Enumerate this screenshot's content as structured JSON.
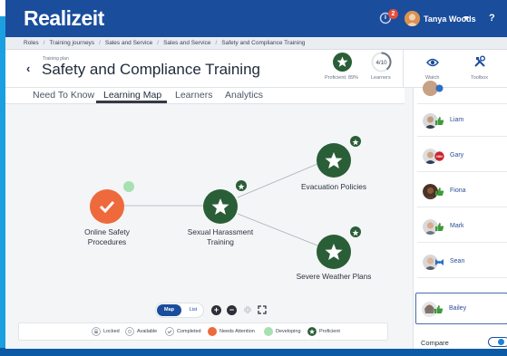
{
  "app": {
    "logo": "Realizeit",
    "notification_count": "2",
    "user_name": "Tanya Woods",
    "help": "?"
  },
  "breadcrumb": [
    "Roles",
    "Training journeys",
    "Sales and Service",
    "Sales and Service",
    "Safety and Compliance Training"
  ],
  "header": {
    "back": "‹",
    "subtitle": "Training plan",
    "title": "Safety and Compliance Training",
    "proficient": "Proficient: 89%",
    "learners_count": "4/10",
    "learners_label": "Learners",
    "watch_label": "Watch",
    "toolbox_label": "Toolbox"
  },
  "tabs": [
    {
      "label": "Need To Know",
      "active": false
    },
    {
      "label": "Learning Map",
      "active": true
    },
    {
      "label": "Learners",
      "active": false
    },
    {
      "label": "Analytics",
      "active": false
    }
  ],
  "map": {
    "nodes": {
      "online_safety": {
        "line1": "Online Safety",
        "line2": "Procedures",
        "status": "Needs Attention",
        "icon": "check-icon"
      },
      "sexual_harassment": {
        "line1": "Sexual Harassment",
        "line2": "Training",
        "status": "Proficient",
        "icon": "star-icon"
      },
      "evacuation": {
        "line1": "Evacuation Policies",
        "status": "Proficient",
        "icon": "star-icon"
      },
      "severe_weather": {
        "line1": "Severe Weather Plans",
        "status": "Proficient",
        "icon": "star-icon"
      }
    },
    "controls": {
      "map": "Map",
      "list": "List",
      "zoom_in": "+",
      "zoom_out": "−"
    }
  },
  "legend": [
    {
      "label": "Locked",
      "color": "#ffffff"
    },
    {
      "label": "Available",
      "color": "#ffffff"
    },
    {
      "label": "Completed",
      "color": "#ffffff"
    },
    {
      "label": "Needs Attention",
      "color": "#ee6a3c"
    },
    {
      "label": "Developing",
      "color": "#a8e0b3"
    },
    {
      "label": "Proficient",
      "color": "#2a5e37"
    }
  ],
  "learners": [
    {
      "name": "Liam",
      "status": "thumbs-up"
    },
    {
      "name": "Gary",
      "status": "needs-badge",
      "badge_text": "NIN"
    },
    {
      "name": "Fiona",
      "status": "thumbs-up"
    },
    {
      "name": "Mark",
      "status": "thumbs-up"
    },
    {
      "name": "Sean",
      "status": "ribbon"
    },
    {
      "name": "Bailey",
      "status": "thumbs-up",
      "selected": true
    }
  ],
  "compare": {
    "label": "Compare",
    "enabled": true
  },
  "colors": {
    "brand": "#1a4d9c",
    "proficient": "#2a5e37",
    "needs_attention": "#ee6a3c",
    "developing": "#a8e0b3",
    "accent": "#1aa0e0"
  }
}
